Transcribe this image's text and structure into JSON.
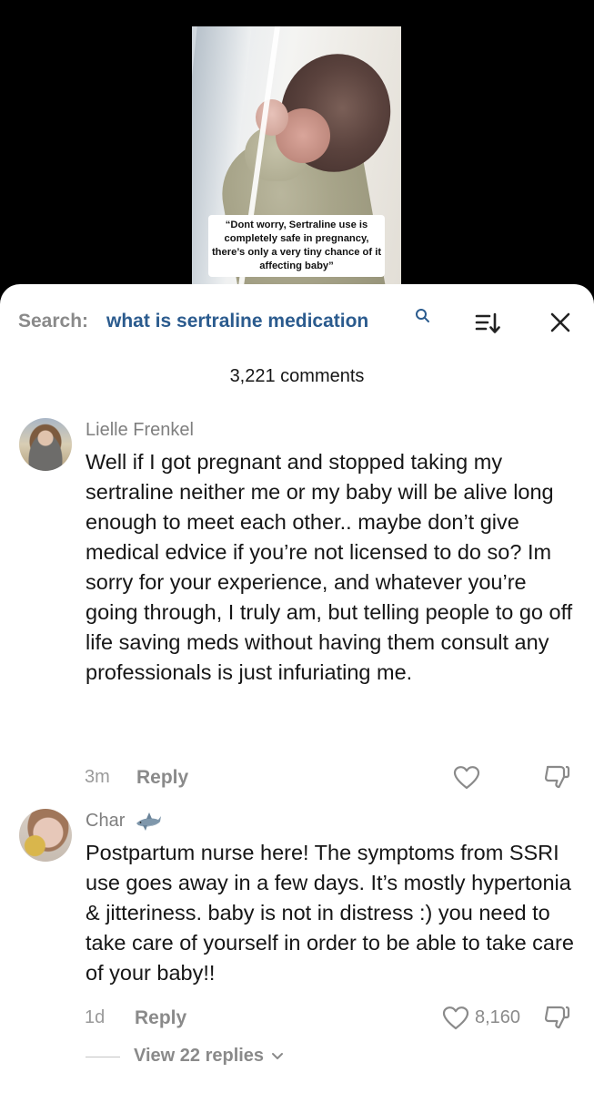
{
  "video": {
    "caption": "“Dont worry, Sertraline use is completely safe in pregnancy, there’s only a very tiny chance of it affecting baby”"
  },
  "search": {
    "prefix": "Search:",
    "term": "what is sertraline medication",
    "icon": "search-icon"
  },
  "header": {
    "comment_count": "3,221 comments",
    "sort_icon": "sort-icon",
    "close_icon": "close-icon"
  },
  "comments": [
    {
      "username": "Lielle Frenkel",
      "text": "Well if I got pregnant and stopped taking my sertraline neither me or my baby will be alive long enough to meet each other.. maybe don’t give medical edvice if you’re not licensed to do so? Im sorry for your experience, and whatever you’re going through, I truly am, but telling people to go off life saving meds without having them consult any professionals is just infuriating me.",
      "time": "3m",
      "reply_label": "Reply",
      "likes": ""
    },
    {
      "username": "Char",
      "name_icon": "shark-icon",
      "text": "Postpartum nurse here! The symptoms from SSRI use goes away in a few days. It’s mostly hypertonia & jitteriness. baby is not in distress :) you need to take care of yourself in order to be able to take care of your baby!!",
      "time": "1d",
      "reply_label": "Reply",
      "likes": "8,160",
      "view_replies": "View 22 replies"
    }
  ],
  "colors": {
    "search_term": "#2b5b8e",
    "muted": "#8a8a8a",
    "text": "#161616"
  }
}
